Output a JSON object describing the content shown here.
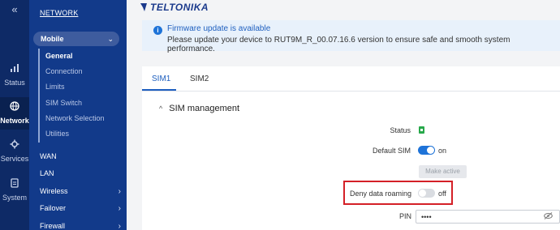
{
  "rail": {
    "toggle_icon": "«",
    "items": [
      {
        "label": "Status",
        "icon": "bars-icon"
      },
      {
        "label": "Network",
        "icon": "globe-icon"
      },
      {
        "label": "Services",
        "icon": "gear-icon"
      },
      {
        "label": "System",
        "icon": "file-icon"
      }
    ]
  },
  "menu": {
    "title": "NETWORK",
    "group": "Mobile",
    "submenu": [
      "General",
      "Connection",
      "Limits",
      "SIM Switch",
      "Network Selection",
      "Utilities"
    ],
    "items": [
      "WAN",
      "LAN",
      "Wireless",
      "Failover",
      "Firewall"
    ]
  },
  "header": {
    "logo": "TELTONIKA"
  },
  "alert": {
    "title": "Firmware update is available",
    "message": "Please update your device to RUT9M_R_00.07.16.6 version to ensure safe and smooth system performance."
  },
  "tabs": [
    "SIM1",
    "SIM2"
  ],
  "section": {
    "title": "SIM management"
  },
  "fields": {
    "status_label": "Status",
    "default_sim_label": "Default SIM",
    "default_sim_state": "on",
    "make_active_label": "Make active",
    "deny_roaming_label": "Deny data roaming",
    "deny_roaming_state": "off",
    "pin_label": "PIN",
    "pin_value": "••••"
  },
  "colors": {
    "sidebar": "#0e2a66",
    "menu": "#123a8a",
    "accent": "#1e73d8",
    "highlight": "#d42027"
  }
}
